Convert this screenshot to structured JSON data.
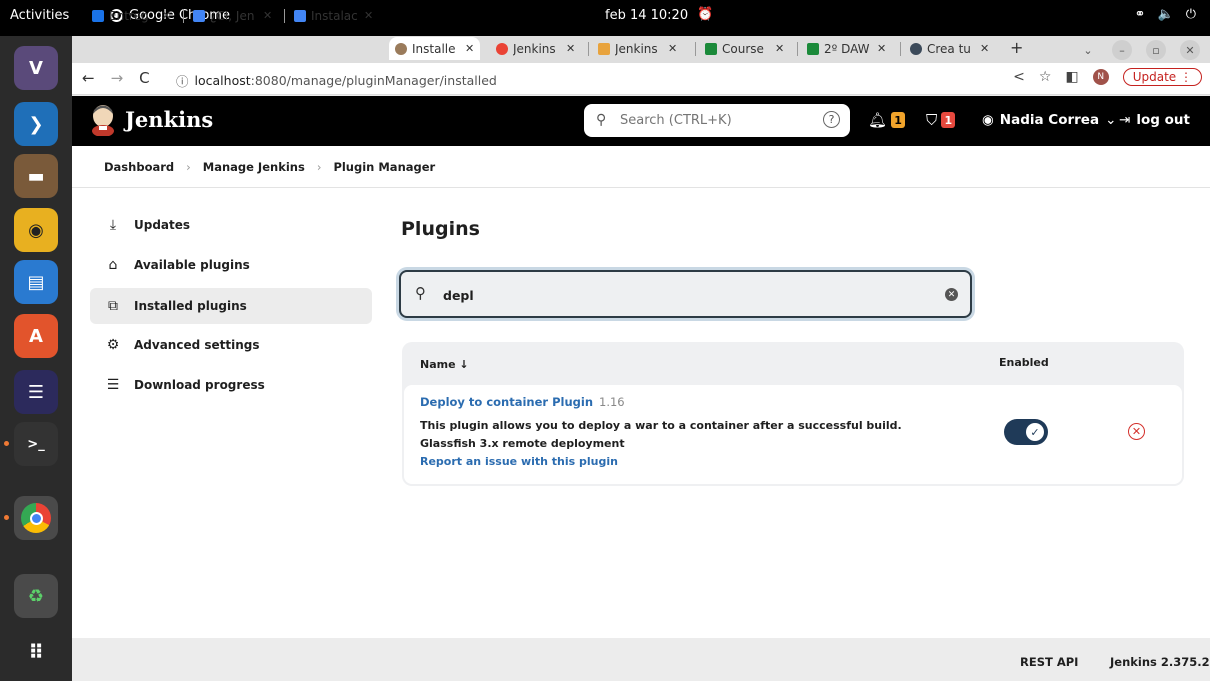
{
  "system": {
    "activities": "Activities",
    "app_name": "Google Chrome",
    "clock": "feb 14  10:20"
  },
  "browser": {
    "tabs": [
      {
        "label": "Entreg",
        "color": "#1a73e8"
      },
      {
        "label": "¿CI, Jen",
        "color": "#4285f4"
      },
      {
        "label": "Instalac",
        "color": "#4285f4"
      },
      {
        "label": "Installe",
        "color": "#9a7b5b",
        "selected": true
      },
      {
        "label": "Jenkins",
        "color": "#ea4335"
      },
      {
        "label": "Jenkins",
        "color": "#e8a33d"
      },
      {
        "label": "Course",
        "color": "#1b8a3a"
      },
      {
        "label": "2º DAW",
        "color": "#1b8a3a"
      },
      {
        "label": "Crea tu",
        "color": "#3c4a5a"
      }
    ],
    "url_host": "localhost",
    "url_path": ":8080/manage/pluginManager/installed",
    "update_label": "Update",
    "profile_initial": "N"
  },
  "jenkins": {
    "brand": "Jenkins",
    "search_placeholder": "Search (CTRL+K)",
    "notifications_count": "1",
    "security_count": "1",
    "user_name": "Nadia Correa",
    "logout_label": "log out"
  },
  "breadcrumb": [
    "Dashboard",
    "Manage Jenkins",
    "Plugin Manager"
  ],
  "sidebar": {
    "items": [
      {
        "label": "Updates",
        "icon": "download-icon"
      },
      {
        "label": "Available plugins",
        "icon": "shopping-bag-icon"
      },
      {
        "label": "Installed plugins",
        "icon": "puzzle-icon",
        "active": true
      },
      {
        "label": "Advanced settings",
        "icon": "gear-icon"
      },
      {
        "label": "Download progress",
        "icon": "list-icon"
      }
    ]
  },
  "main": {
    "title": "Plugins",
    "filter_value": "depl",
    "table": {
      "col_name": "Name ↓",
      "col_enabled": "Enabled",
      "rows": [
        {
          "name": "Deploy to container Plugin",
          "version": "1.16",
          "description_1": "This plugin allows you to deploy a war to a container after a successful build.",
          "description_2": "Glassfish 3.x remote deployment",
          "report_link": "Report an issue with this plugin",
          "enabled": true
        }
      ]
    }
  },
  "footer": {
    "rest_api": "REST API",
    "version": "Jenkins 2.375.2"
  },
  "colors": {
    "link": "#2b6cb0",
    "toggle_on": "#1f3a58",
    "danger": "#d4302b",
    "notify_badge": "#f0a32b",
    "security_badge": "#e6493e"
  }
}
